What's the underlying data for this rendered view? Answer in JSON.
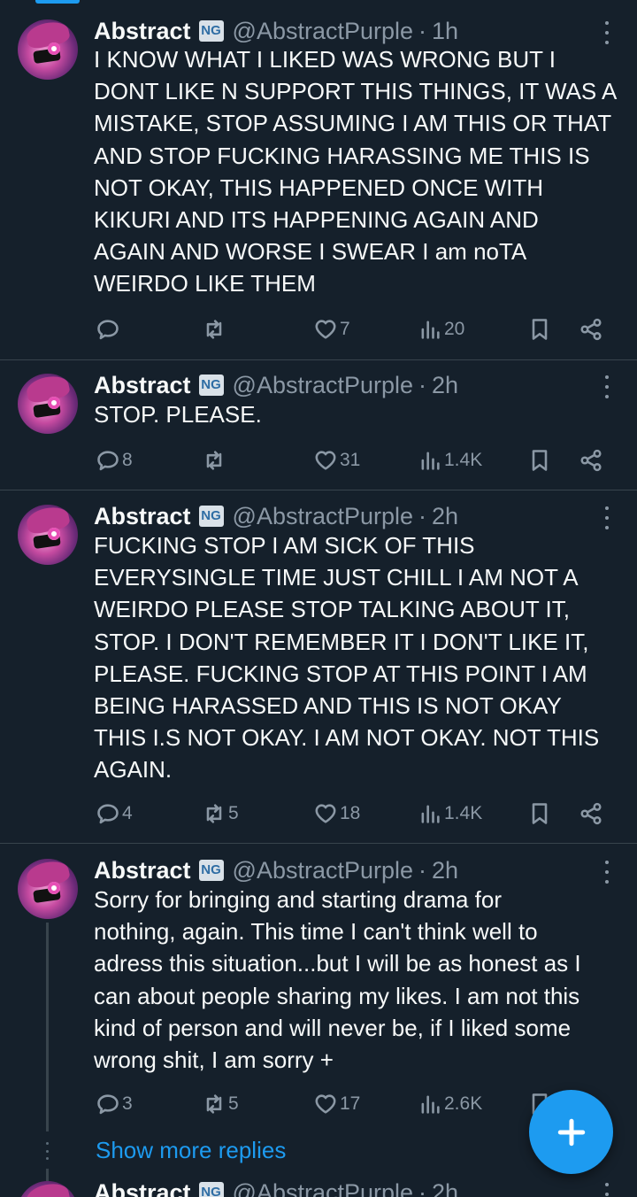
{
  "colors": {
    "background": "#15202b",
    "text": "#f7f9f9",
    "muted": "#8b98a5",
    "accent": "#1d9bf0",
    "divider": "#38444d"
  },
  "tweets": [
    {
      "name": "Abstract",
      "badge": "NG",
      "handle": "@AbstractPurple",
      "time": "1h",
      "text": "I KNOW WHAT I LIKED WAS WRONG BUT I\nDONT LIKE N SUPPORT THIS THINGS, IT WAS A\nMISTAKE, STOP ASSUMING I AM THIS OR THAT\nAND STOP FUCKING HARASSING ME THIS IS\nNOT OKAY, THIS HAPPENED ONCE WITH\nKIKURI AND ITS HAPPENING AGAIN AND\nAGAIN AND WORSE I SWEAR I am noTA\nWEIRDO LIKE THEM",
      "replies": "",
      "retweets": "",
      "likes": "7",
      "views": "20"
    },
    {
      "name": "Abstract",
      "badge": "NG",
      "handle": "@AbstractPurple",
      "time": "2h",
      "text": "STOP. PLEASE.",
      "replies": "8",
      "retweets": "",
      "likes": "31",
      "views": "1.4K"
    },
    {
      "name": "Abstract",
      "badge": "NG",
      "handle": "@AbstractPurple",
      "time": "2h",
      "text": "FUCKING STOP I AM SICK OF THIS\nEVERYSINGLE TIME JUST CHILL I AM NOT A\nWEIRDO PLEASE STOP TALKING ABOUT IT,\nSTOP. I DON'T REMEMBER IT I DON'T LIKE IT,\nPLEASE. FUCKING STOP AT THIS POINT I AM\nBEING HARASSED AND THIS IS NOT OKAY\nTHIS I.S NOT OKAY. I AM NOT OKAY. NOT THIS\nAGAIN.",
      "replies": "4",
      "retweets": "5",
      "likes": "18",
      "views": "1.4K"
    },
    {
      "name": "Abstract",
      "badge": "NG",
      "handle": "@AbstractPurple",
      "time": "2h",
      "text": "Sorry for bringing and starting drama for\nnothing, again. This time I can't think well to\nadress this situation...but I will be as honest as I\ncan about people sharing my likes. I am not this\nkind  of person and will never be, if I liked some\nwrong shit, I am sorry +",
      "replies": "3",
      "retweets": "5",
      "likes": "17",
      "views": "2.6K"
    },
    {
      "name": "Abstract",
      "badge": "NG",
      "handle": "@AbstractPurple",
      "time": "2h"
    }
  ],
  "show_more": "Show more replies",
  "fab_icon": "plus-icon"
}
